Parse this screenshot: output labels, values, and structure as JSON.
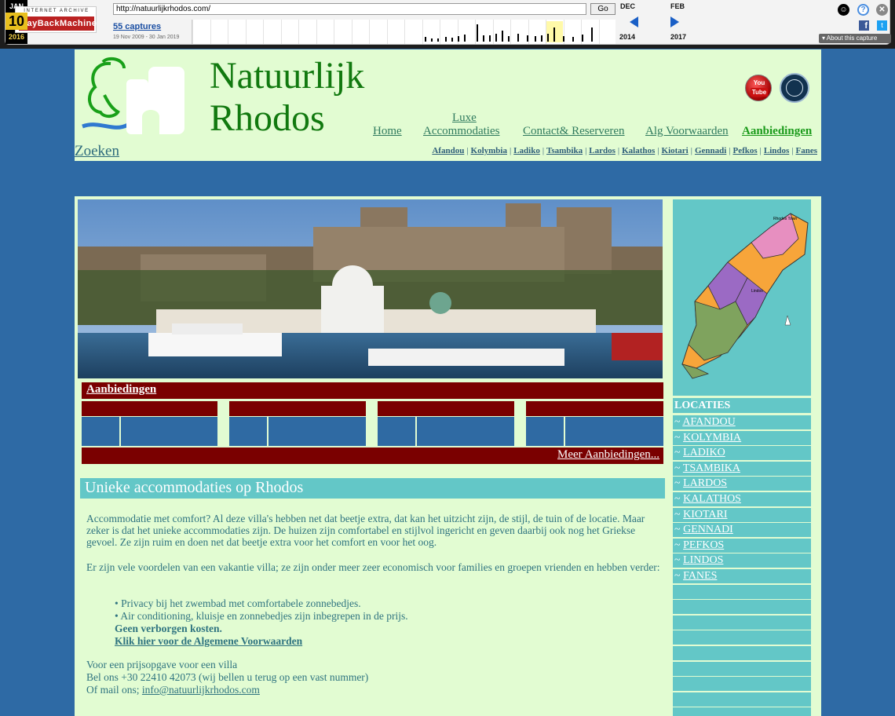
{
  "wayback": {
    "logo_top": "INTERNET ARCHIVE",
    "logo_bottom": "WayBackMachine",
    "url": "http://natuurlijkrhodos.com/",
    "go": "Go",
    "captures": "55 captures",
    "range": "19 Nov 2009 - 30 Jan 2019",
    "prev_month": "DEC",
    "cur_month": "JAN",
    "cur_day": "10",
    "cur_year": "2016",
    "next_month": "FEB",
    "prev_year": "2014",
    "next_year": "2017",
    "about": "About this capture"
  },
  "header": {
    "title_line1": "Natuurlijk",
    "title_line2": "Rhodos",
    "nav": {
      "home": "Home",
      "acc_line1": "Luxe",
      "acc_line2": "Accommodaties",
      "contact": "Contact& Reserveren",
      "alg": "Alg Voorwaarden",
      "aanb": "Aanbiedingen"
    },
    "zoeken": "Zoeken",
    "youtube_l1": "You",
    "youtube_l2": "Tube",
    "subnav": [
      "Afandou",
      "Kolymbia",
      "Ladiko",
      "Tsambika",
      "Lardos",
      "Kalathos",
      "Kiotari",
      "Gennadi",
      "Pefkos",
      "Lindos",
      "Fanes"
    ]
  },
  "main": {
    "aanbiedingen_title": "Aanbiedingen",
    "meer": "Meer Aanbiedingen...",
    "uniek_title": "Unieke accommodaties op Rhodos",
    "p1": "Accommodatie met comfort? Al deze villa's hebben net dat beetje extra, dat kan het uitzicht zijn, de stijl, de tuin of de locatie. Maar zeker is dat het unieke accommodaties zijn. De huizen zijn comfortabel en stijlvol ingericht en geven daarbij ook nog het Griekse gevoel. Ze zijn ruim en doen net dat beetje extra voor het comfort en voor het oog.",
    "p2": "Er zijn vele voordelen van een vakantie villa; ze zijn onder meer zeer economisch voor families en groepen vrienden en hebben verder:",
    "bullet1": "• Privacy bij het zwembad met comfortabele zonnebedjes.",
    "bullet2": "• Air conditioning, kluisje en zonnebedjes zijn inbegrepen in de prijs.",
    "bold1": "Geen verborgen kosten.",
    "link1": "Klik hier voor de Algemene Voorwaarden",
    "contact1": "Voor een prijsopgave voor een villa",
    "contact2": "Bel ons +30 22410 42073 (wij bellen u terug op een vast nummer)",
    "contact3_prefix": "Of mail ons; ",
    "contact3_email": "info@natuurlijkrhodos.com"
  },
  "sidebar": {
    "map_label": "Rhodes Town",
    "map_label2": "Lindos",
    "locaties": "LOCATIES",
    "items": [
      "AFANDOU",
      "KOLYMBIA",
      "LADIKO",
      "TSAMBIKA",
      "LARDOS",
      "KALATHOS",
      "KIOTARI",
      "GENNADI",
      "PEFKOS",
      "LINDOS",
      "FANES"
    ]
  },
  "colors": {
    "page_bg": "#2e6aa5",
    "panel_bg": "#e2fcd2",
    "title_green": "#11790f",
    "dark_red": "#7a0000",
    "teal": "#63c7c7"
  }
}
